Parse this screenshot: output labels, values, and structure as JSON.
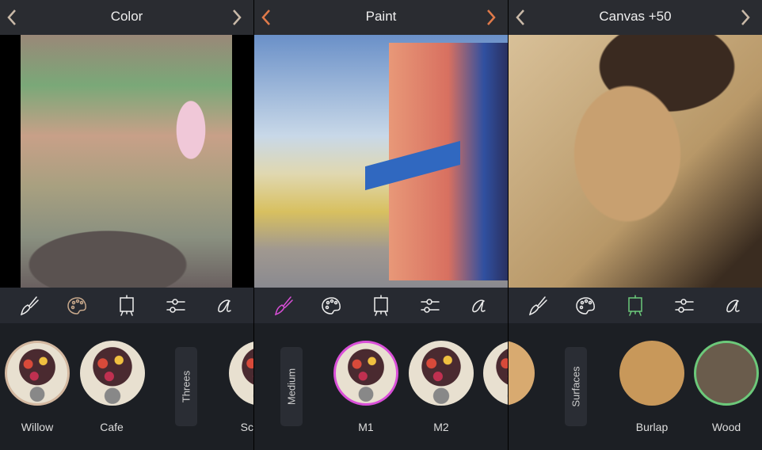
{
  "colors": {
    "header": "#2a2c31",
    "toolbar": "#272a31",
    "bottom": "#1c1f24",
    "accent_color": "#c8a98c",
    "accent_paint": "#d94fd8",
    "accent_canvas": "#6cc97a",
    "chevron_paint": "#e07a4a",
    "chevron_default": "#c9b9a8"
  },
  "panels": [
    {
      "title": "Color",
      "active_tool": "palette",
      "section": "Threes",
      "items": [
        {
          "label": "Willow",
          "selected": true
        },
        {
          "label": "Cafe"
        },
        {
          "label": "Sc"
        }
      ]
    },
    {
      "title": "Paint",
      "active_tool": "brush",
      "section": "Medium",
      "items": [
        {
          "label": "M1",
          "selected": true
        },
        {
          "label": "M2"
        }
      ]
    },
    {
      "title": "Canvas +50",
      "active_tool": "easel",
      "section": "Surfaces",
      "items": [
        {
          "label": "Burlap"
        },
        {
          "label": "Wood",
          "selected": true
        }
      ]
    }
  ],
  "toolbar_icons": [
    "brush-icon",
    "palette-icon",
    "easel-icon",
    "sliders-icon",
    "script-a-icon"
  ]
}
